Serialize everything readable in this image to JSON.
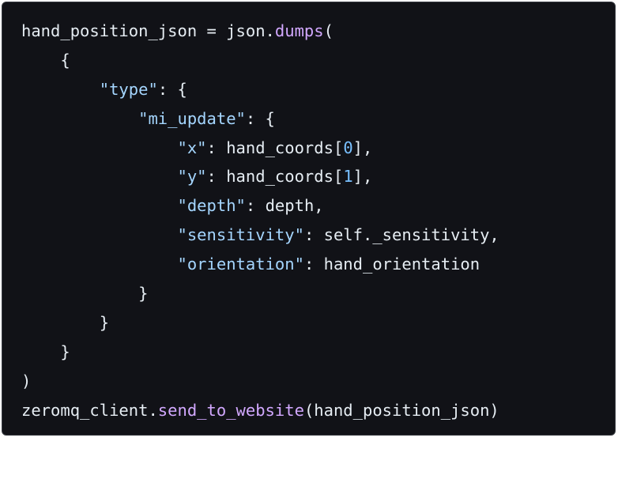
{
  "code": {
    "lines": [
      [
        {
          "t": "hand_position_json = json.",
          "k": "plain"
        },
        {
          "t": "dumps",
          "k": "fn"
        },
        {
          "t": "(",
          "k": "punc"
        }
      ],
      [
        {
          "t": "    {",
          "k": "punc"
        }
      ],
      [
        {
          "t": "        ",
          "k": "plain"
        },
        {
          "t": "\"type\"",
          "k": "key"
        },
        {
          "t": ": {",
          "k": "punc"
        }
      ],
      [
        {
          "t": "            ",
          "k": "plain"
        },
        {
          "t": "\"mi_update\"",
          "k": "key"
        },
        {
          "t": ": {",
          "k": "punc"
        }
      ],
      [
        {
          "t": "                ",
          "k": "plain"
        },
        {
          "t": "\"x\"",
          "k": "key"
        },
        {
          "t": ": hand_coords[",
          "k": "plain"
        },
        {
          "t": "0",
          "k": "num"
        },
        {
          "t": "],",
          "k": "punc"
        }
      ],
      [
        {
          "t": "                ",
          "k": "plain"
        },
        {
          "t": "\"y\"",
          "k": "key"
        },
        {
          "t": ": hand_coords[",
          "k": "plain"
        },
        {
          "t": "1",
          "k": "num"
        },
        {
          "t": "],",
          "k": "punc"
        }
      ],
      [
        {
          "t": "                ",
          "k": "plain"
        },
        {
          "t": "\"depth\"",
          "k": "key"
        },
        {
          "t": ": depth,",
          "k": "plain"
        }
      ],
      [
        {
          "t": "                ",
          "k": "plain"
        },
        {
          "t": "\"sensitivity\"",
          "k": "key"
        },
        {
          "t": ": self._sensitivity,",
          "k": "plain"
        }
      ],
      [
        {
          "t": "                ",
          "k": "plain"
        },
        {
          "t": "\"orientation\"",
          "k": "key"
        },
        {
          "t": ": hand_orientation",
          "k": "plain"
        }
      ],
      [
        {
          "t": "            }",
          "k": "punc"
        }
      ],
      [
        {
          "t": "        }",
          "k": "punc"
        }
      ],
      [
        {
          "t": "    }",
          "k": "punc"
        }
      ],
      [
        {
          "t": ")",
          "k": "punc"
        }
      ],
      [
        {
          "t": "zeromq_client.",
          "k": "plain"
        },
        {
          "t": "send_to_website",
          "k": "fn"
        },
        {
          "t": "(hand_position_json)",
          "k": "plain"
        }
      ]
    ]
  },
  "colors": {
    "background": "#111217",
    "text": "#e6edf3",
    "function": "#d2a8ff",
    "string_key": "#a5d6ff",
    "number": "#79c0ff"
  }
}
